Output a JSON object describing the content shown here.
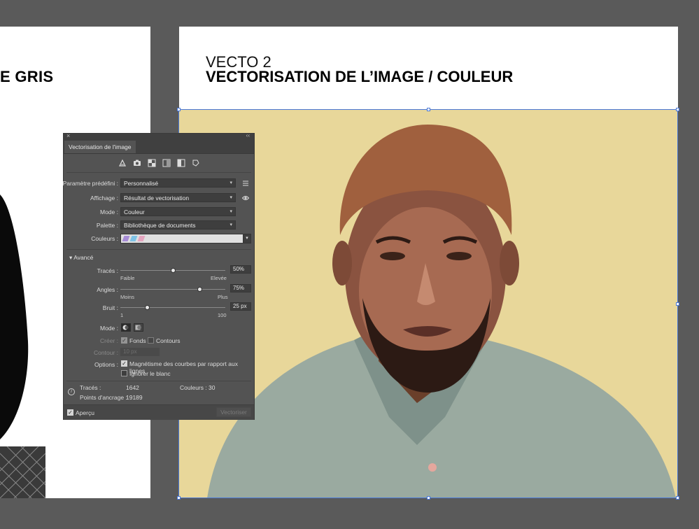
{
  "left_artboard": {
    "title_fragment": "E GRIS"
  },
  "right_artboard": {
    "subtitle": "VECTO 2",
    "title": "VECTORISATION DE L’IMAGE / COULEUR"
  },
  "panel": {
    "tab_label": "Vectorisation de l'image",
    "preset_icons": [
      "auto-color-icon",
      "high-color-icon",
      "low-color-icon",
      "grayscale-icon",
      "black-white-icon",
      "outline-icon"
    ],
    "preset": {
      "label": "Paramètre prédéfini :",
      "value": "Personnalisé"
    },
    "display": {
      "label": "Affichage :",
      "value": "Résultat de vectorisation"
    },
    "mode": {
      "label": "Mode :",
      "value": "Couleur"
    },
    "palette": {
      "label": "Palette :",
      "value": "Bibliothèque de documents"
    },
    "colors": {
      "label": "Couleurs :",
      "swatches": [
        "#a78cd6",
        "#7fc3e6",
        "#e6a6c0"
      ]
    },
    "advanced": {
      "label": "Avancé"
    },
    "paths": {
      "label": "Tracés :",
      "value": "50%",
      "level": 0.5,
      "min_label": "Faible",
      "max_label": "Elevée"
    },
    "angles": {
      "label": "Angles :",
      "value": "75%",
      "level": 0.75,
      "min_label": "Moins",
      "max_label": "Plus"
    },
    "noise": {
      "label": "Bruit :",
      "value": "25 px",
      "level": 0.25,
      "min_label": "1",
      "max_label": "100"
    },
    "mode2": {
      "label": "Mode :"
    },
    "create": {
      "label": "Créer :",
      "fills": "Fonds",
      "strokes": "Contours"
    },
    "stroke": {
      "label": "Contour :",
      "value": "10 px"
    },
    "options": {
      "label": "Options :",
      "snap": "Magnétisme des courbes par rapport aux lignes",
      "ignore_white": "Ignorer le blanc"
    },
    "stats": {
      "paths_label": "Tracés :",
      "paths_value": "1642",
      "colors_label": "Couleurs :",
      "colors_value": "30",
      "anchors_label": "Points d'ancrage :",
      "anchors_value": "19189"
    },
    "preview": {
      "label": "Aperçu"
    },
    "trace_button": {
      "label": "Vectoriser"
    }
  }
}
